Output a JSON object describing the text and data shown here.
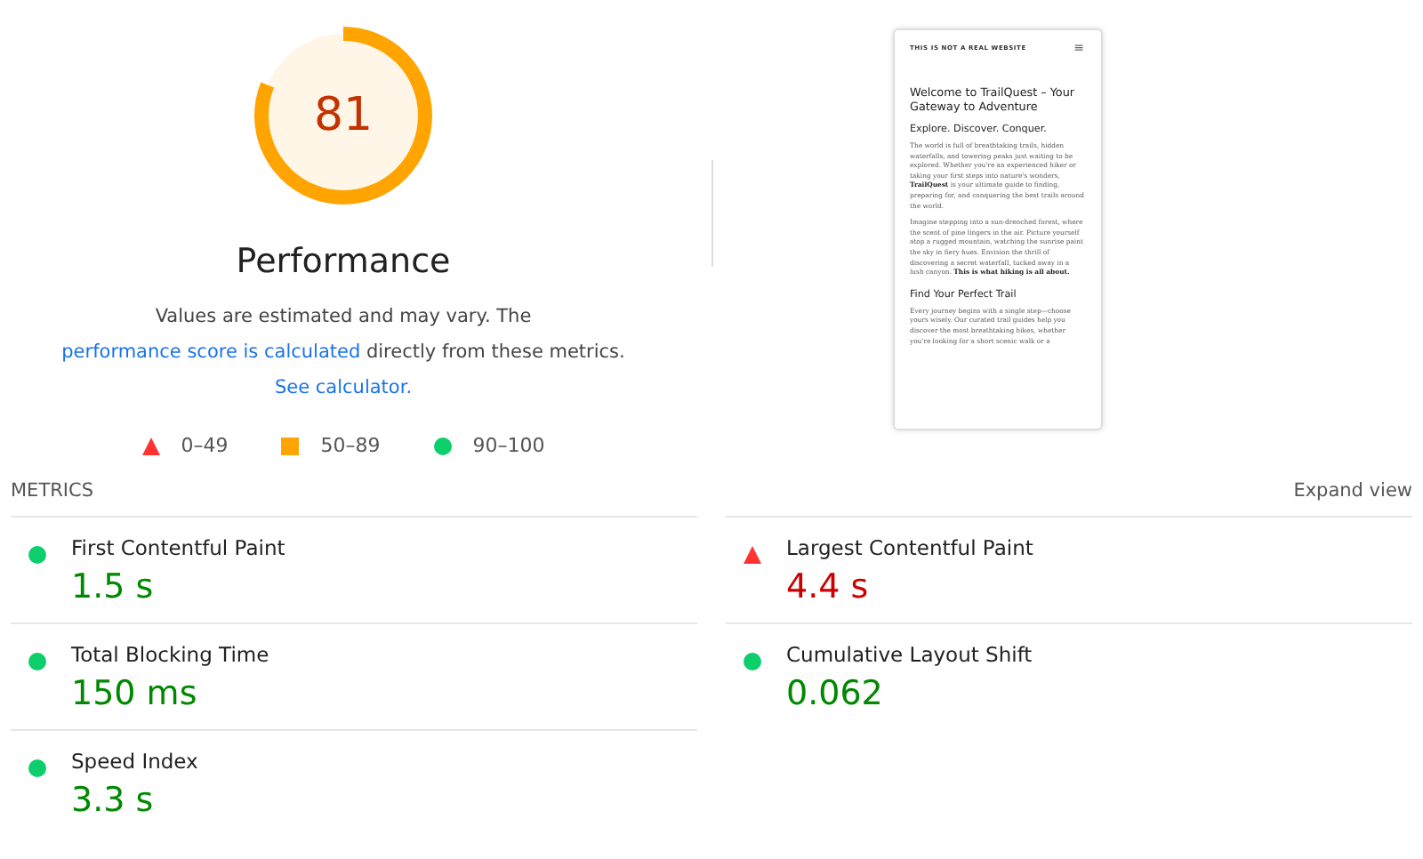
{
  "gauge": {
    "score": "81",
    "kind": "average",
    "label": "Performance"
  },
  "description": {
    "text": "Values are estimated and may vary. The ",
    "link": "performance score is calculated",
    "text2": " directly from these metrics. ",
    "link2": "See calculator."
  },
  "legend": [
    {
      "kind": "fail",
      "range": "0–49"
    },
    {
      "kind": "average",
      "range": "50–89"
    },
    {
      "kind": "pass",
      "range": "90–100"
    }
  ],
  "screenshot": {
    "site_title": "THIS IS NOT A REAL WEBSITE",
    "menu": "≡",
    "heading": "Welcome to TrailQuest – Your Gateway to Adventure",
    "subheading": "Explore. Discover. Conquer.",
    "paragraphs": [
      "The world is full of breathtaking trails, hidden waterfalls, and towering peaks just waiting to be explored. Whether you're an experienced hiker or taking your first steps into nature's wonders, **TrailQuest** is your ultimate guide to finding, preparing for, and conquering the best trails around the world.",
      "Imagine stepping into a sun-drenched forest, where the scent of pine lingers in the air. Picture yourself atop a rugged mountain, watching the sunrise paint the sky in fiery hues. Envision the thrill of discovering a secret waterfall, tucked away in a lush canyon. **This is what hiking is all about.**"
    ],
    "section_heading": "Find Your Perfect Trail",
    "last_paragraph": "Every journey begins with a single step—choose yours wisely. Our curated trail guides help you discover the most breathtaking hikes, whether you're looking for a short scenic walk or a"
  },
  "metrics": {
    "title": "METRICS",
    "toggle": "Expand view",
    "items": [
      {
        "name": "First Contentful Paint",
        "value": "1.5 s",
        "kind": "pass"
      },
      {
        "name": "Largest Contentful Paint",
        "value": "4.4 s",
        "kind": "fail"
      },
      {
        "name": "Total Blocking Time",
        "value": "150 ms",
        "kind": "pass"
      },
      {
        "name": "Cumulative Layout Shift",
        "value": "0.062",
        "kind": "pass"
      },
      {
        "name": "Speed Index",
        "value": "3.3 s",
        "kind": "pass"
      }
    ]
  }
}
